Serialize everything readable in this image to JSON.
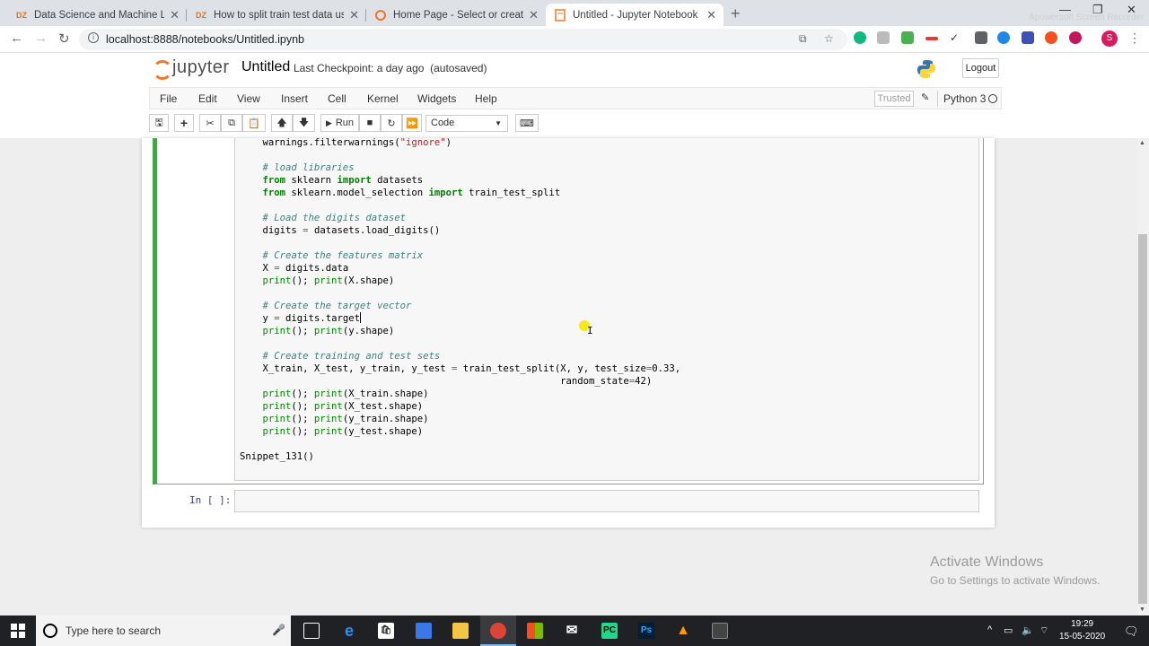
{
  "browser": {
    "tabs": [
      {
        "favicon": "DZ",
        "title": "Data Science and Machine Learni",
        "active": false
      },
      {
        "favicon": "DZ",
        "title": "How to split train test data using",
        "active": false
      },
      {
        "favicon": "spinner-icon",
        "title": "Home Page - Select or create a n",
        "active": false
      },
      {
        "favicon": "notebook-icon",
        "title": "Untitled - Jupyter Notebook",
        "active": true
      }
    ],
    "new_tab": "+",
    "url": "localhost:8888/notebooks/Untitled.ipynb",
    "profile_initial": "S",
    "recorder_watermark": "Apowersoft Screen Recorder"
  },
  "jupyter": {
    "logo_text": "jupyter",
    "notebook_name": "Untitled",
    "checkpoint": "Last Checkpoint: a day ago",
    "autosaved": "(autosaved)",
    "logout": "Logout",
    "menu": [
      "File",
      "Edit",
      "View",
      "Insert",
      "Cell",
      "Kernel",
      "Widgets",
      "Help"
    ],
    "trusted": "Trusted",
    "kernel": "Python 3",
    "toolbar": {
      "run_label": "Run",
      "cell_type": "Code"
    },
    "cell_code_lines": [
      "    warnings.filterwarnings(\"ignore\")",
      "",
      "    # load libraries",
      "    from sklearn import datasets",
      "    from sklearn.model_selection import train_test_split",
      "",
      "    # Load the digits dataset",
      "    digits = datasets.load_digits()",
      "",
      "    # Create the features matrix",
      "    X = digits.data",
      "    print(); print(X.shape)",
      "",
      "    # Create the target vector",
      "    y = digits.target",
      "    print(); print(y.shape)",
      "",
      "    # Create training and test sets",
      "    X_train, X_test, y_train, y_test = train_test_split(X, y, test_size=0.33,",
      "                                                        random_state=42)",
      "    print(); print(X_train.shape)",
      "    print(); print(X_test.shape)",
      "    print(); print(y_train.shape)",
      "    print(); print(y_test.shape)",
      "",
      "Snippet_131()"
    ],
    "next_prompt": "In [ ]:"
  },
  "windows": {
    "activate_title": "Activate Windows",
    "activate_sub": "Go to Settings to activate Windows.",
    "search_placeholder": "Type here to search",
    "time": "19:29",
    "date": "15-05-2020"
  }
}
